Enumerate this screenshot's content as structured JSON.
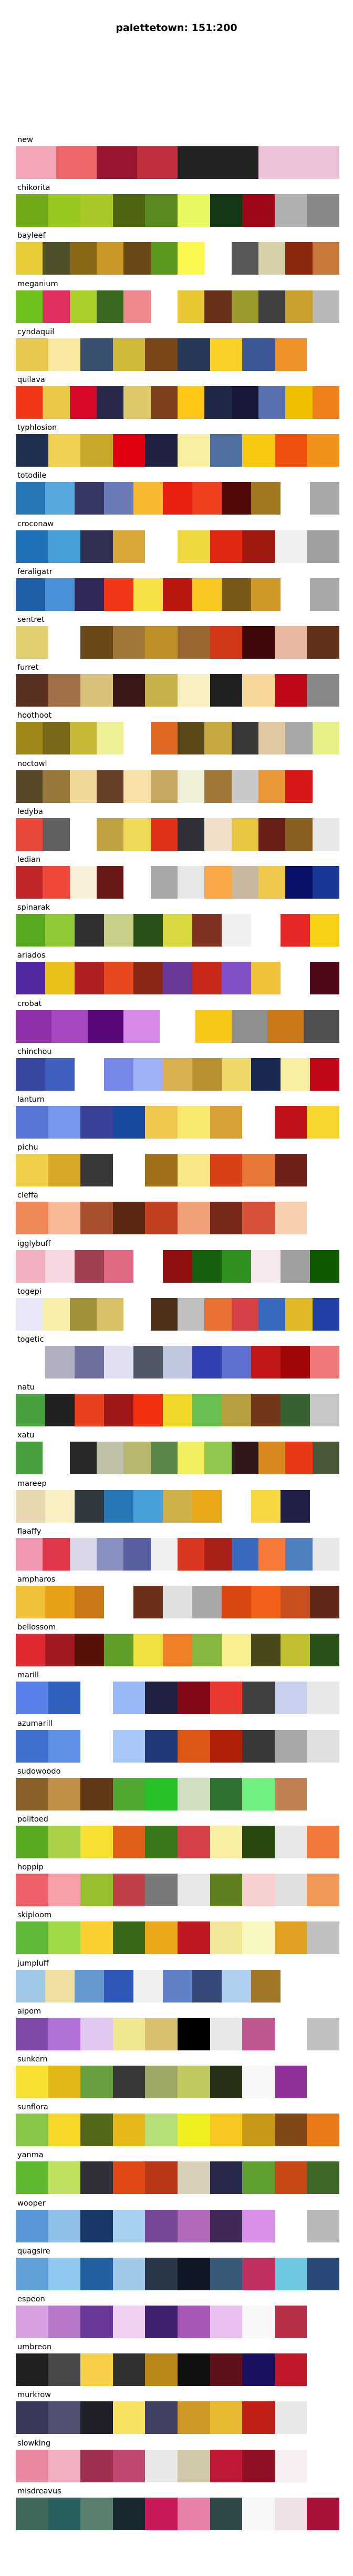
{
  "chart_data": {
    "type": "palette-swatches",
    "title": "palettetown: 151:200",
    "palettes": [
      {
        "name": "new",
        "colors": [
          "#F4A6B8",
          "#F0676A",
          "#9A1530",
          "#C2303F",
          "#232323",
          "#232323",
          "#ECC2D8",
          "#ECC2D8"
        ]
      },
      {
        "name": "chikorita",
        "colors": [
          "#70AA18",
          "#98C820",
          "#A8C828",
          "#4F6410",
          "#5A8A20",
          "#E8F860",
          "#143818",
          "#A00818",
          "#B0B0B0",
          "#888888"
        ]
      },
      {
        "name": "bayleef",
        "colors": [
          "#E8CC38",
          "#505028",
          "#8A6818",
          "#C89828",
          "#6A4818",
          "#5A9820",
          "#F8F850",
          "#FFFFFF",
          "#585858",
          "#D8D0A8",
          "#8A2810",
          "#C87838"
        ]
      },
      {
        "name": "meganium",
        "colors": [
          "#70C020",
          "#E03060",
          "#A8D028",
          "#3A6820",
          "#F08890",
          "#FFFFFF",
          "#E8C830",
          "#683018",
          "#9A9A2A",
          "#404040",
          "#C8A030",
          "#B8B8B8"
        ]
      },
      {
        "name": "cyndaquil",
        "colors": [
          "#E8C850",
          "#F8E8A0",
          "#385070",
          "#D0B838",
          "#7A4818",
          "#283858",
          "#F8D028",
          "#3A5898",
          "#F09028",
          "#FFFFFF"
        ]
      },
      {
        "name": "quilava",
        "colors": [
          "#F03818",
          "#EAC848",
          "#D80828",
          "#282848",
          "#E0C868",
          "#804020",
          "#FFC818",
          "#202848",
          "#181838",
          "#5870B0",
          "#F0C000",
          "#F08018"
        ]
      },
      {
        "name": "typhlosion",
        "colors": [
          "#203050",
          "#F0D050",
          "#C8A828",
          "#E00010",
          "#202040",
          "#F8F0A0",
          "#5070A0",
          "#F8C810",
          "#F05010",
          "#F09018"
        ]
      },
      {
        "name": "totodile",
        "colors": [
          "#2878B8",
          "#58A8E0",
          "#383868",
          "#6A7AB8",
          "#F8B830",
          "#E82010",
          "#F04020",
          "#500808",
          "#A07820",
          "#FFFFFF",
          "#A8A8A8"
        ]
      },
      {
        "name": "croconaw",
        "colors": [
          "#2070B8",
          "#48A0D8",
          "#303050",
          "#D8A838",
          "#FFFFFF",
          "#F0D840",
          "#E02810",
          "#A01810",
          "#F0F0F0",
          "#A0A0A0"
        ]
      },
      {
        "name": "feraligatr",
        "colors": [
          "#2060A8",
          "#4890D8",
          "#302858",
          "#F03818",
          "#F8E048",
          "#B81810",
          "#F8C820",
          "#7A5818",
          "#D09828",
          "#FFFFFF",
          "#A8A8A8"
        ]
      },
      {
        "name": "sentret",
        "colors": [
          "#E0D070",
          "#FFFFFF",
          "#6A4818",
          "#A07838",
          "#C09028",
          "#986830",
          "#D03818",
          "#400808",
          "#E8B8A0",
          "#603018"
        ]
      },
      {
        "name": "furret",
        "colors": [
          "#5A3020",
          "#A07048",
          "#D8C078",
          "#3A1818",
          "#C8B048",
          "#F8F0C0",
          "#202020",
          "#F8D898",
          "#C00818",
          "#888888"
        ]
      },
      {
        "name": "hoothoot",
        "colors": [
          "#A08818",
          "#786818",
          "#C8B838",
          "#F0F098",
          "#FFFFFF",
          "#E06820",
          "#5A4818",
          "#C8A840",
          "#383838",
          "#E0C8A0",
          "#A8A8A8",
          "#E8F088"
        ]
      },
      {
        "name": "noctowl",
        "colors": [
          "#584828",
          "#987838",
          "#F0D898",
          "#684028",
          "#F8E0A8",
          "#C8A860",
          "#F0F0D8",
          "#A07838",
          "#C8C8C8",
          "#E89838",
          "#D81818",
          "#FFFFFF"
        ]
      },
      {
        "name": "ledyba",
        "colors": [
          "#E84838",
          "#606060",
          "#FFFFFF",
          "#C0A040",
          "#F0D858",
          "#E03018",
          "#303038",
          "#F0E0C8",
          "#E8C840",
          "#6A2018",
          "#886020",
          "#E8E8E8"
        ]
      },
      {
        "name": "ledian",
        "colors": [
          "#C02828",
          "#F04838",
          "#F8F0D8",
          "#6A1818",
          "#FFFFFF",
          "#A8A8A8",
          "#E8E8E8",
          "#F8A848",
          "#C8B8A0",
          "#F0C850",
          "#081068",
          "#183898"
        ]
      },
      {
        "name": "spinarak",
        "colors": [
          "#58A820",
          "#90C838",
          "#303030",
          "#C8D088",
          "#285018",
          "#D8D840",
          "#803020",
          "#F0F0F0",
          "#FFFFFF",
          "#E82828",
          "#F8D018"
        ]
      },
      {
        "name": "ariados",
        "colors": [
          "#5028A0",
          "#E8C018",
          "#B02020",
          "#E84820",
          "#8A2818",
          "#6A3898",
          "#C82818",
          "#8050C8",
          "#F0C038",
          "#FFFFFF",
          "#500818"
        ]
      },
      {
        "name": "crobat",
        "colors": [
          "#9030A8",
          "#A848C0",
          "#580878",
          "#D888E8",
          "#FFFFFF",
          "#F8C818",
          "#909090",
          "#C87818",
          "#505050"
        ]
      },
      {
        "name": "chinchou",
        "colors": [
          "#3848A0",
          "#4060C0",
          "#FFFFFF",
          "#7888E8",
          "#A0B0F8",
          "#D8B050",
          "#B89030",
          "#F0D868",
          "#182850",
          "#F8F0A0",
          "#C00818"
        ]
      },
      {
        "name": "lanturn",
        "colors": [
          "#5878D8",
          "#7898F0",
          "#384098",
          "#1848A0",
          "#F0C850",
          "#F8E870",
          "#D8A038",
          "#FFFFFF",
          "#C01018",
          "#F8D830"
        ]
      },
      {
        "name": "pichu",
        "colors": [
          "#F0D048",
          "#D8A828",
          "#383838",
          "#FFFFFF",
          "#A07018",
          "#F8E888",
          "#D84018",
          "#E87838",
          "#702018",
          "#FFFFFF"
        ]
      },
      {
        "name": "cleffa",
        "colors": [
          "#F08858",
          "#F8B898",
          "#A85030",
          "#5A2810",
          "#C04020",
          "#F0A078",
          "#782818",
          "#D85038",
          "#F8D0B0",
          "#FFFFFF"
        ]
      },
      {
        "name": "igglybuff",
        "colors": [
          "#F0B0C0",
          "#F8D8E0",
          "#A04050",
          "#E06880",
          "#FFFFFF",
          "#901010",
          "#186010",
          "#309020",
          "#F8E8F0",
          "#A0A0A0",
          "#105800"
        ]
      },
      {
        "name": "togepi",
        "colors": [
          "#E8E8F8",
          "#F8F0A8",
          "#A09038",
          "#D8C068",
          "#FFFFFF",
          "#503018",
          "#C0C0C0",
          "#E87030",
          "#D84048",
          "#3868C0",
          "#E0B828",
          "#2040A8"
        ]
      },
      {
        "name": "togetic",
        "colors": [
          "#FFFFFF",
          "#B0B0C0",
          "#7070A0",
          "#E0E0F0",
          "#505868",
          "#C0C8E0",
          "#3040B0",
          "#6070D0",
          "#C01818",
          "#A00808",
          "#F07878"
        ]
      },
      {
        "name": "natu",
        "colors": [
          "#48A040",
          "#202020",
          "#E84020",
          "#A01818",
          "#F03010",
          "#F0D828",
          "#68C050",
          "#B8A040",
          "#703818",
          "#386030",
          "#C8C8C8"
        ]
      },
      {
        "name": "xatu",
        "colors": [
          "#48A040",
          "#FFFFFF",
          "#282828",
          "#C0C0A8",
          "#B8B870",
          "#5A8848",
          "#F0F060",
          "#90C850",
          "#301818",
          "#D88820",
          "#E83818",
          "#485838"
        ]
      },
      {
        "name": "mareep",
        "colors": [
          "#E8D8B0",
          "#F8F0C0",
          "#303840",
          "#2878B8",
          "#48A0D8",
          "#D0B048",
          "#E8A818",
          "#FFFFFF",
          "#F8D840",
          "#202048",
          "#FFFFFF"
        ]
      },
      {
        "name": "flaaffy",
        "colors": [
          "#F098B0",
          "#E03848",
          "#D8D8E8",
          "#8890C0",
          "#5860A0",
          "#F0F0F0",
          "#D83820",
          "#A82018",
          "#3868C0",
          "#F87838",
          "#5080C0",
          "#E8E8E8"
        ]
      },
      {
        "name": "ampharos",
        "colors": [
          "#F0C038",
          "#E8A018",
          "#C87818",
          "#FFFFFF",
          "#6A3018",
          "#E0E0E0",
          "#A8A8A8",
          "#D84810",
          "#F06018",
          "#C85020",
          "#602818"
        ]
      },
      {
        "name": "bellossom",
        "colors": [
          "#E02830",
          "#A01820",
          "#581008",
          "#60A028",
          "#F0E040",
          "#F08028",
          "#88B840",
          "#F8F090",
          "#484818",
          "#C0C030",
          "#285018"
        ]
      },
      {
        "name": "marill",
        "colors": [
          "#5880E8",
          "#3060C0",
          "#FFFFFF",
          "#98B8F8",
          "#202040",
          "#800818",
          "#E83830",
          "#404040",
          "#C8D0F0",
          "#E8E8E8"
        ]
      },
      {
        "name": "azumarill",
        "colors": [
          "#4070D0",
          "#6090E8",
          "#FFFFFF",
          "#A8C8F8",
          "#203878",
          "#E05818",
          "#B02008",
          "#383838",
          "#A8A8A8",
          "#E0E0E0"
        ]
      },
      {
        "name": "sudowoodo",
        "colors": [
          "#886028",
          "#C09048",
          "#603818",
          "#50A830",
          "#28C028",
          "#D0E0C0",
          "#307030",
          "#70F080",
          "#C08050",
          "#FFFFFF"
        ]
      },
      {
        "name": "politoed",
        "colors": [
          "#58A820",
          "#A8D048",
          "#F8E030",
          "#E06018",
          "#387818",
          "#D84048",
          "#F8F0A0",
          "#2A4810",
          "#E8E8E8",
          "#F07838"
        ]
      },
      {
        "name": "hoppip",
        "colors": [
          "#F06068",
          "#F8A0A8",
          "#98C030",
          "#C04048",
          "#787878",
          "#E8E8E8",
          "#608020",
          "#F8D0D0",
          "#E0E0E0",
          "#F09858"
        ]
      },
      {
        "name": "skiploom",
        "colors": [
          "#60B838",
          "#A0D848",
          "#F8D030",
          "#386818",
          "#E8A818",
          "#C01820",
          "#F0E898",
          "#F8F8C0",
          "#E0A020",
          "#C0C0C0"
        ]
      },
      {
        "name": "jumpluff",
        "colors": [
          "#A0C8E8",
          "#F0E0A0",
          "#6898D0",
          "#3058B8",
          "#F0F0F0",
          "#6080C8",
          "#384878",
          "#B0D0F0",
          "#A07828",
          "#FFFFFF",
          "#FFFFFF"
        ]
      },
      {
        "name": "aipom",
        "colors": [
          "#8048A8",
          "#B070D8",
          "#E0C8F0",
          "#F0E890",
          "#D8C070",
          "#000000",
          "#E8E8E8",
          "#C05890",
          "#FFFFFF",
          "#C0C0C0"
        ]
      },
      {
        "name": "sunkern",
        "colors": [
          "#F8E030",
          "#E0B818",
          "#68A040",
          "#383838",
          "#A0A868",
          "#C0C860",
          "#283018",
          "#F8F8F8",
          "#903098",
          "#FFFFFF"
        ]
      },
      {
        "name": "sunflora",
        "colors": [
          "#88C848",
          "#F8D828",
          "#506818",
          "#E8B818",
          "#B8E078",
          "#F0F020",
          "#F8C820",
          "#C89818",
          "#804818",
          "#E87818"
        ]
      },
      {
        "name": "yanma",
        "colors": [
          "#60B830",
          "#C0E060",
          "#303038",
          "#E04818",
          "#B83818",
          "#D8D0B8",
          "#282848",
          "#60A030",
          "#C84818",
          "#406828"
        ]
      },
      {
        "name": "wooper",
        "colors": [
          "#5898D8",
          "#90C0E8",
          "#183868",
          "#A8D0F0",
          "#784898",
          "#B068B8",
          "#402858",
          "#D890E8",
          "#FFFFFF",
          "#B8B8B8"
        ]
      },
      {
        "name": "quagsire",
        "colors": [
          "#60A0D8",
          "#90C8F0",
          "#2060A0",
          "#A0C8E8",
          "#283848",
          "#101828",
          "#385878",
          "#C03060",
          "#70C8E0",
          "#284878"
        ]
      },
      {
        "name": "espeon",
        "colors": [
          "#D8A0E0",
          "#B878C8",
          "#6A3898",
          "#F0D0F0",
          "#402070",
          "#A858B8",
          "#E8C0F0",
          "#F8F8F8",
          "#B83048",
          "#FFFFFF"
        ]
      },
      {
        "name": "umbreon",
        "colors": [
          "#202020",
          "#484848",
          "#F8D048",
          "#303030",
          "#B88818",
          "#101010",
          "#601018",
          "#1A1060",
          "#C01828",
          "#FFFFFF"
        ]
      },
      {
        "name": "murkrow",
        "colors": [
          "#383858",
          "#505070",
          "#202028",
          "#F8E060",
          "#404060",
          "#D09828",
          "#E8B830",
          "#C02018",
          "#E8E8E8",
          "#FFFFFF"
        ]
      },
      {
        "name": "slowking",
        "colors": [
          "#E888A0",
          "#F0B0C0",
          "#A03050",
          "#C04870",
          "#E8E8E8",
          "#D0C8A8",
          "#C01838",
          "#901028",
          "#F8F0F0",
          "#FFFFFF"
        ]
      },
      {
        "name": "misdreavus",
        "colors": [
          "#406858",
          "#286060",
          "#5A8070",
          "#182830",
          "#C81858",
          "#E880A8",
          "#304848",
          "#F8F8F8",
          "#F0E0E8",
          "#A81038"
        ]
      }
    ]
  }
}
